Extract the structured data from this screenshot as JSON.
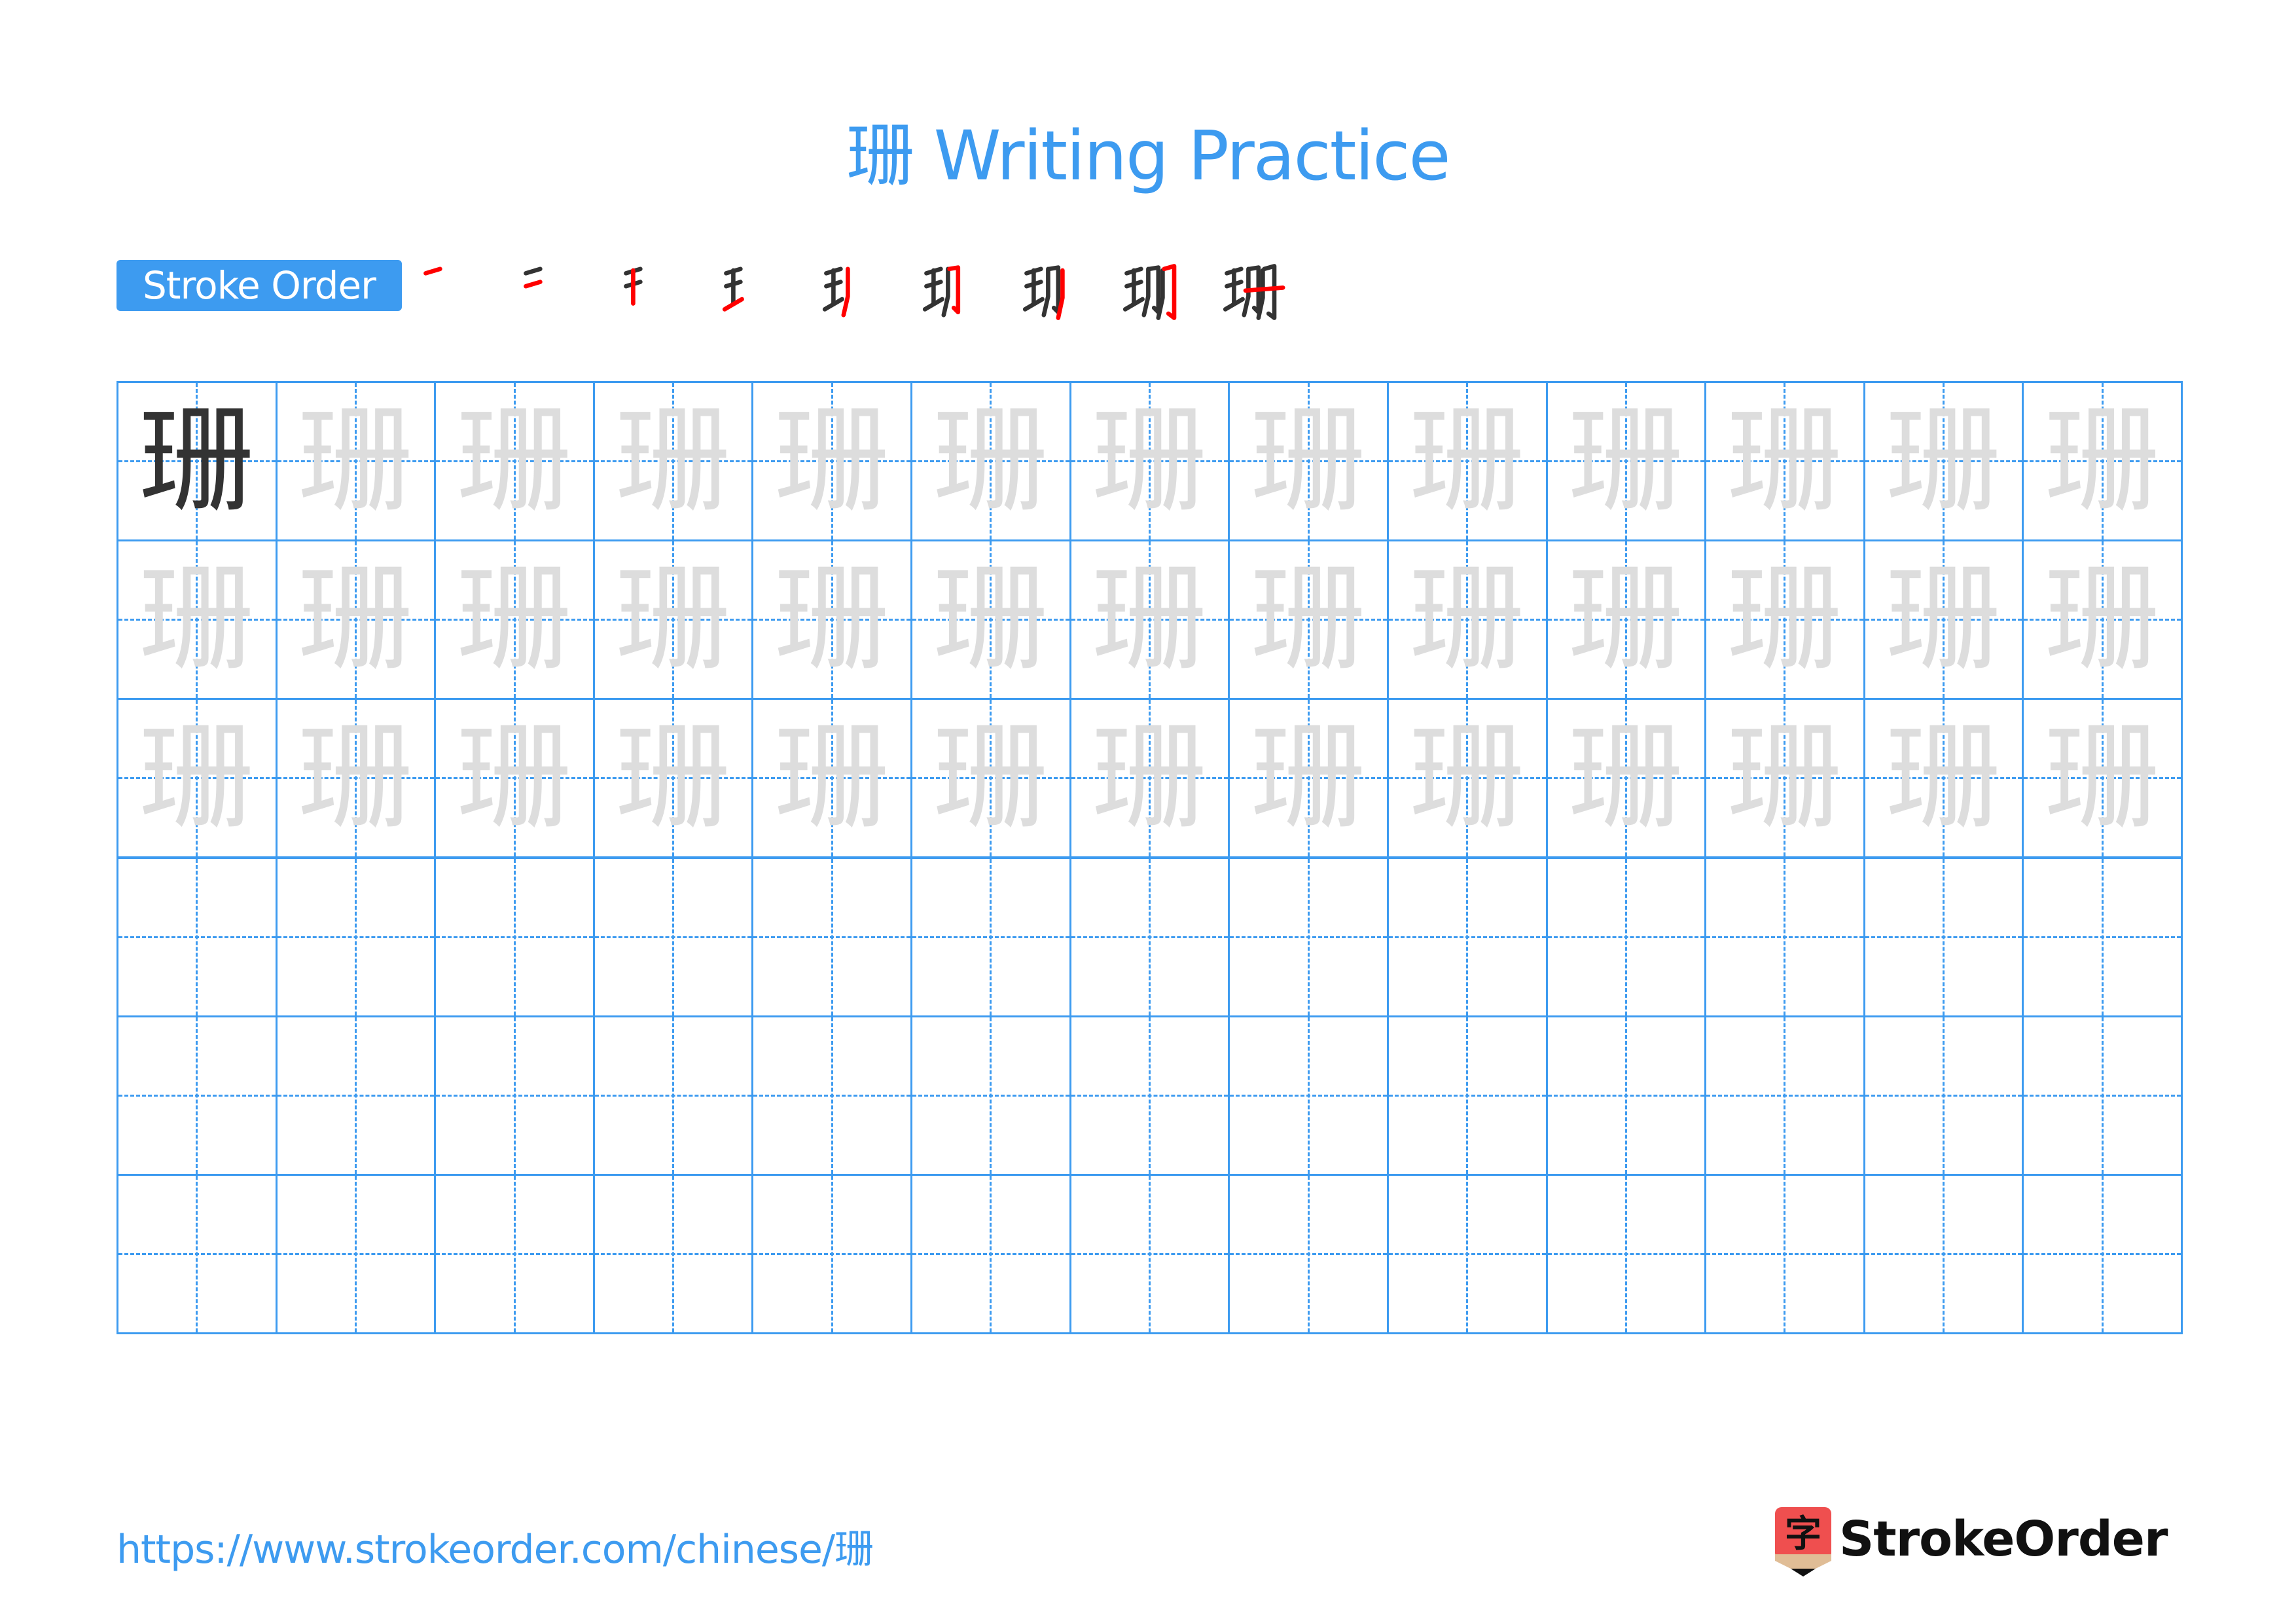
{
  "page": {
    "title": "珊 Writing Practice",
    "character": "珊"
  },
  "stroke_order": {
    "label": "Stroke Order",
    "total_strokes": 9,
    "steps": [
      {
        "step": 1,
        "description": "horizontal (top of 王)"
      },
      {
        "step": 2,
        "description": "horizontal (middle of 王)"
      },
      {
        "step": 3,
        "description": "vertical (王)"
      },
      {
        "step": 4,
        "description": "rising stroke (bottom of 王)"
      },
      {
        "step": 5,
        "description": "left-falling (first 冂 of 册)"
      },
      {
        "step": 6,
        "description": "hooked turn (first 冂 of 册)"
      },
      {
        "step": 7,
        "description": "left-falling (second 冂 of 册)"
      },
      {
        "step": 8,
        "description": "hooked turn (second 冂 of 册)"
      },
      {
        "step": 9,
        "description": "horizontal crossing (册)"
      }
    ],
    "colors": {
      "current": "#ff0000",
      "previous": "#333333"
    }
  },
  "grid": {
    "rows": 6,
    "cols": 13,
    "model_rows": [
      {
        "row": 1,
        "first_cell": "solid",
        "rest": "trace"
      },
      {
        "row": 2,
        "all": "trace"
      },
      {
        "row": 3,
        "all": "trace"
      }
    ],
    "empty_rows": 3,
    "colors": {
      "line": "#3d9bf0",
      "solid_char": "#333333",
      "trace_char": "#dddddd"
    }
  },
  "footer": {
    "url": "https://www.strokeorder.com/chinese/珊",
    "brand": "StrokeOrder",
    "brand_icon_glyph": "字"
  },
  "icons": {
    "logo": "pencil-zi-logo-icon"
  }
}
